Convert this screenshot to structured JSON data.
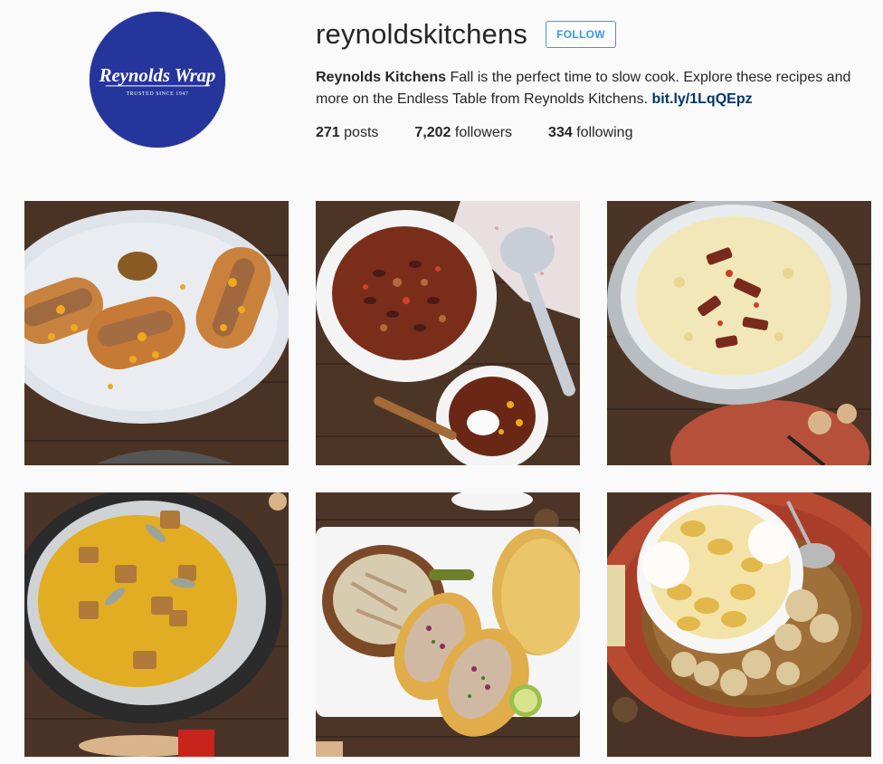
{
  "profile": {
    "username": "reynoldskitchens",
    "follow_label": "FOLLOW",
    "avatar": {
      "logo_text": "Reynolds Wrap",
      "tagline": "TRUSTED SINCE 1947",
      "background_color": "#26359c"
    },
    "bio": {
      "name": "Reynolds Kitchens",
      "text": "Fall is the perfect time to slow cook. Explore these recipes and more on the Endless Table from Reynolds Kitchens.",
      "link": "bit.ly/1LqQEpz"
    },
    "stats": {
      "posts_count": "271",
      "posts_label": "posts",
      "followers_count": "7,202",
      "followers_label": "followers",
      "following_count": "334",
      "following_label": "following"
    }
  },
  "posts": [
    {
      "subject": "hot dogs with cheese and onions on a white platter"
    },
    {
      "subject": "bowl of turkey and bean chili with sour cream"
    },
    {
      "subject": "cheesy potato soup with bacon in slow cooker"
    },
    {
      "subject": "butternut squash soup with croutons and sage in slow cooker"
    },
    {
      "subject": "shredded chicken tacos on a white tray"
    },
    {
      "subject": "baked apples with vanilla ice cream in a bowl"
    }
  ],
  "colors": {
    "accent": "#3897f0",
    "link": "#003569",
    "text": "#262626",
    "background": "#fafafa"
  }
}
